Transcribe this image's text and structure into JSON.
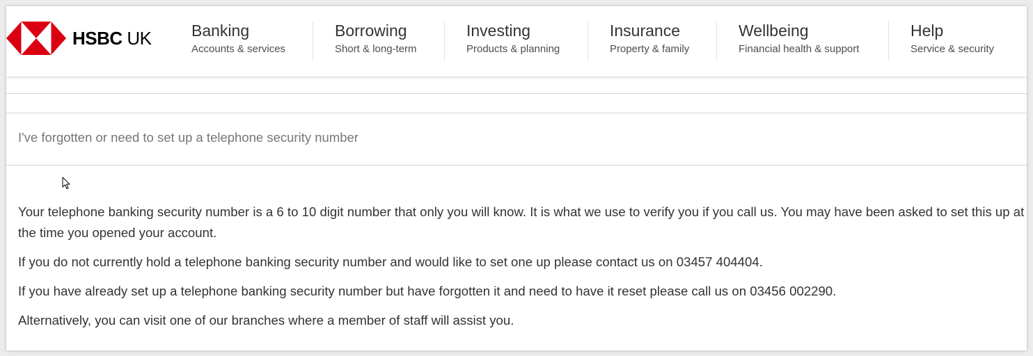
{
  "brand": {
    "name_bold": "HSBC",
    "name_rest": " UK",
    "colors": {
      "red": "#db0011",
      "white": "#ffffff"
    }
  },
  "nav": [
    {
      "title": "Banking",
      "subtitle": "Accounts & services"
    },
    {
      "title": "Borrowing",
      "subtitle": "Short & long-term"
    },
    {
      "title": "Investing",
      "subtitle": "Products & planning"
    },
    {
      "title": "Insurance",
      "subtitle": "Property & family"
    },
    {
      "title": "Wellbeing",
      "subtitle": "Financial health & support"
    },
    {
      "title": "Help",
      "subtitle": "Service & security"
    }
  ],
  "faq": {
    "question": "I've forgotten or need to set up a telephone security number",
    "answer": [
      "Your telephone banking security number is a 6 to 10 digit number that only you will know. It is what we use to verify you if you call us. You may have been asked to set this up at the time you opened your account.",
      "If you do not currently hold a telephone banking security number and would like to set one up please contact us on 03457 404404.",
      "If you have already set up a telephone banking security number but have forgotten it and need to have it reset please call us on 03456 002290.",
      "Alternatively, you can visit one of our branches where a member of staff will assist you."
    ]
  },
  "icons": {
    "logo": "hsbc-hexagon-logo",
    "cursor": "mouse-pointer-icon"
  }
}
